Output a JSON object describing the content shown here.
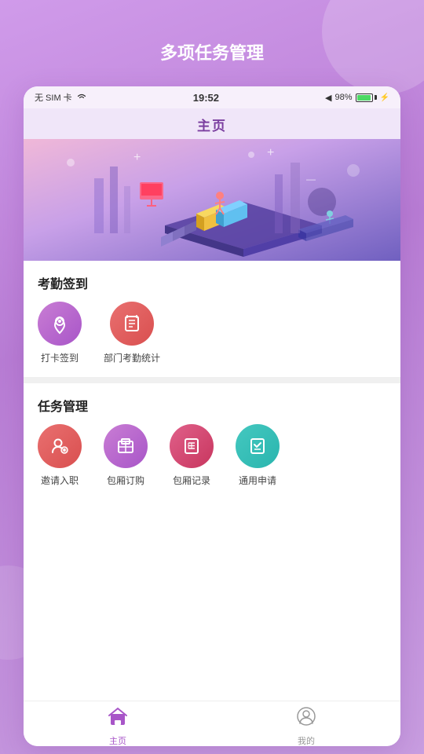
{
  "app": {
    "title": "多项任务管理"
  },
  "status_bar": {
    "left": "无 SIM 卡  ✦",
    "sim_text": "无 SIM 卡",
    "wifi": "wifi",
    "time": "19:52",
    "signal": "◀",
    "battery_percent": "98%"
  },
  "nav_bar": {
    "title": "主页"
  },
  "sections": [
    {
      "id": "attendance",
      "title": "考勤签到",
      "items": [
        {
          "id": "checkin",
          "label": "打卡签到",
          "icon": "📍",
          "color": "color-purple"
        },
        {
          "id": "dept-stat",
          "label": "部门考勤统计",
          "icon": "📋",
          "color": "color-red-orange"
        }
      ]
    },
    {
      "id": "task-mgmt",
      "title": "任务管理",
      "items": [
        {
          "id": "invite",
          "label": "邀请入职",
          "icon": "👤",
          "color": "color-red-orange"
        },
        {
          "id": "pkg-order",
          "label": "包厢订购",
          "icon": "🏢",
          "color": "color-purple"
        },
        {
          "id": "pkg-record",
          "label": "包厢记录",
          "icon": "📋",
          "color": "color-pink-red"
        },
        {
          "id": "general-apply",
          "label": "通用申请",
          "icon": "📝",
          "color": "color-teal"
        }
      ]
    }
  ],
  "tab_bar": {
    "tabs": [
      {
        "id": "home",
        "label": "主页",
        "active": true,
        "icon": "🛍️"
      },
      {
        "id": "profile",
        "label": "我的",
        "active": false,
        "icon": "👤"
      }
    ]
  }
}
